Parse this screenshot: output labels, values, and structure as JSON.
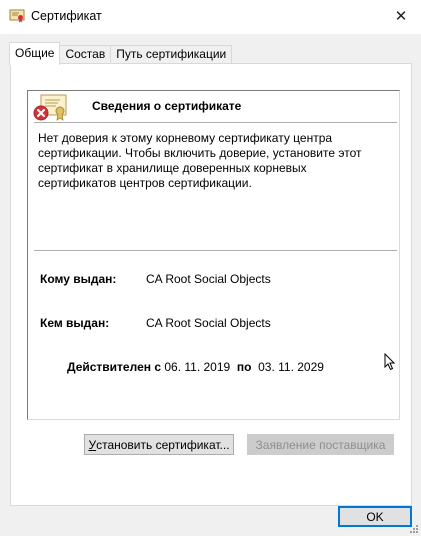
{
  "window": {
    "title": "Сертификат",
    "close_symbol": "✕"
  },
  "tabs": [
    {
      "label": "Общие",
      "active": true
    },
    {
      "label": "Состав",
      "active": false
    },
    {
      "label": "Путь сертификации",
      "active": false
    }
  ],
  "info": {
    "heading": "Сведения о сертификате",
    "warning": "Нет доверия к этому корневому сертификату центра сертификации. Чтобы включить доверие, установите этот сертификат в хранилище доверенных корневых сертификатов центров сертификации.",
    "issued_to_label": "Кому выдан:",
    "issued_to_value": "CA Root Social Objects",
    "issued_by_label": "Кем выдан:",
    "issued_by_value": "CA Root Social Objects",
    "valid_from_label": "Действителен с",
    "valid_from_value": "06. 11. 2019",
    "valid_to_label": "по",
    "valid_to_value": "03. 11. 2029"
  },
  "buttons": {
    "install_prefix": "",
    "install_underlined": "У",
    "install_rest": "становить сертификат...",
    "issuer_statement": "Заявление поставщика",
    "ok": "OK"
  },
  "icons": {
    "title": "certificate-icon",
    "info": "certificate-error-icon",
    "close": "close-icon"
  },
  "colors": {
    "error_red": "#d13438",
    "ok_focus_border": "#0078d7",
    "disabled_text": "#8f8f8f"
  }
}
